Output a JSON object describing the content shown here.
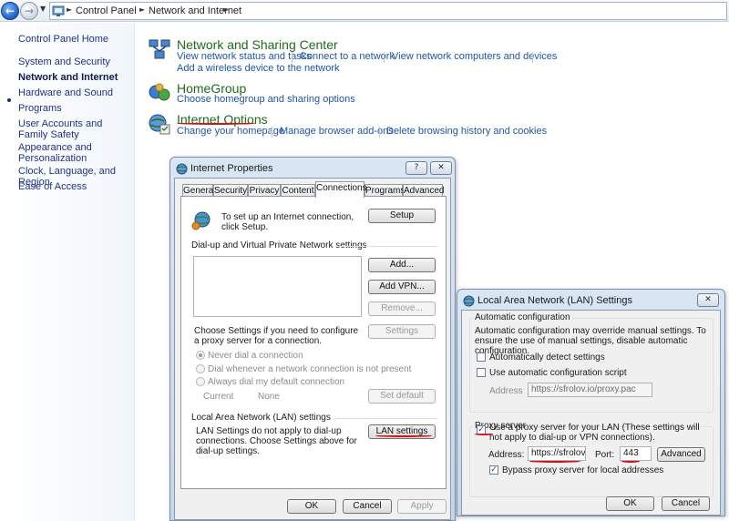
{
  "breadcrumb": {
    "items": [
      "Control Panel",
      "Network and Internet"
    ]
  },
  "leftnav": {
    "items": [
      "Control Panel Home",
      "System and Security",
      "Network and Internet",
      "Hardware and Sound",
      "Programs",
      "User Accounts and Family Safety",
      "Appearance and Personalization",
      "Clock, Language, and Region",
      "Ease of Access"
    ]
  },
  "categories": {
    "network": {
      "title": "Network and Sharing Center",
      "links": [
        "View network status and tasks",
        "Connect to a network",
        "View network computers and devices",
        "Add a wireless device to the network"
      ]
    },
    "homegroup": {
      "title": "HomeGroup",
      "links": [
        "Choose homegroup and sharing options"
      ]
    },
    "internet": {
      "title": "Internet Options",
      "links": [
        "Change your homepage",
        "Manage browser add-ons",
        "Delete browsing history and cookies"
      ]
    }
  },
  "internet_properties": {
    "title": "Internet Properties",
    "tabs": [
      "General",
      "Security",
      "Privacy",
      "Content",
      "Connections",
      "Programs",
      "Advanced"
    ],
    "active_tab": "Connections",
    "setup_text": "To set up an Internet connection, click Setup.",
    "setup_button": "Setup",
    "dialup_group": "Dial-up and Virtual Private Network settings",
    "add_button": "Add...",
    "add_vpn_button": "Add VPN...",
    "remove_button": "Remove...",
    "settings_text": "Choose Settings if you need to configure a proxy server for a connection.",
    "settings_button": "Settings",
    "radio_never": "Never dial a connection",
    "radio_whenever": "Dial whenever a network connection is not present",
    "radio_always": "Always dial my default connection",
    "current_label": "Current",
    "current_value": "None",
    "set_default_button": "Set default",
    "lan_group": "Local Area Network (LAN) settings",
    "lan_text": "LAN Settings do not apply to dial-up connections. Choose Settings above for dial-up settings.",
    "lan_button": "LAN settings",
    "ok_button": "OK",
    "cancel_button": "Cancel",
    "apply_button": "Apply"
  },
  "lan_settings": {
    "title": "Local Area Network (LAN) Settings",
    "auto_group": "Automatic configuration",
    "auto_text": "Automatic configuration may override manual settings.  To ensure the use of manual settings, disable automatic configuration.",
    "auto_detect_label": "Automatically detect settings",
    "auto_detect_checked": false,
    "use_script_label": "Use automatic configuration script",
    "use_script_checked": false,
    "address_label": "Address",
    "script_address": "https://sfrolov.io/proxy.pac",
    "proxy_group": "Proxy server",
    "use_proxy_label": "Use a proxy server for your LAN (These settings will not apply to dial-up or VPN connections).",
    "use_proxy_checked": true,
    "proxy_address_label": "Address:",
    "proxy_address": "https://sfrolov.io",
    "port_label": "Port:",
    "port": "443",
    "advanced_button": "Advanced",
    "bypass_label": "Bypass proxy server for local addresses",
    "bypass_checked": true,
    "ok_button": "OK",
    "cancel_button": "Cancel"
  },
  "icons": [
    "back-arrow-icon",
    "forward-arrow-icon",
    "control-panel-icon",
    "network-icon",
    "homegroup-icon",
    "internet-options-icon",
    "globe-icon",
    "help-icon",
    "close-icon"
  ],
  "colors": {
    "link": "#1e54a8",
    "category_title": "#1e6b1e",
    "annotation": "#d01515",
    "nav_link": "#1e3287"
  }
}
